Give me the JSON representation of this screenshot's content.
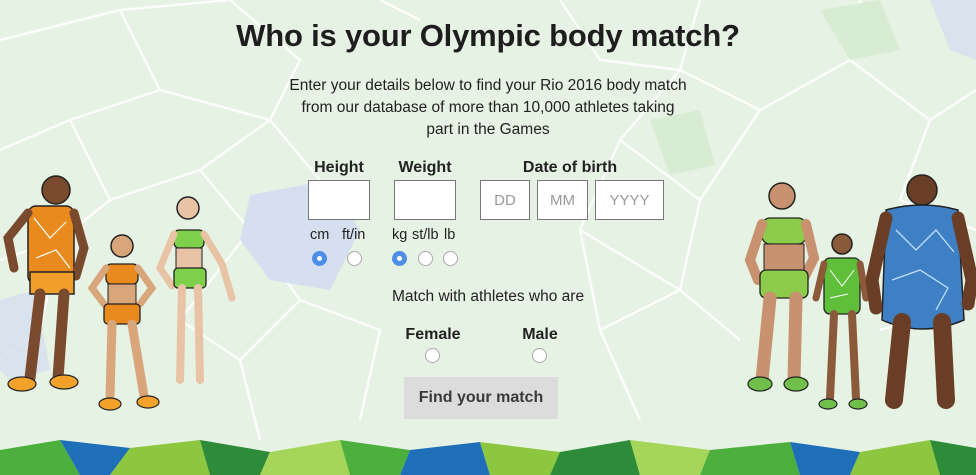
{
  "title": "Who is your Olympic body match?",
  "intro": "Enter your details below to find your Rio 2016 body match from our database of more than 10,000 athletes taking part in the Games",
  "height": {
    "label": "Height",
    "placeholder": "",
    "units": [
      "cm",
      "ft/in"
    ],
    "selected_unit": "cm"
  },
  "weight": {
    "label": "Weight",
    "placeholder": "",
    "units": [
      "kg",
      "st/lb",
      "lb"
    ],
    "selected_unit": "kg"
  },
  "dob": {
    "label": "Date of birth",
    "day_placeholder": "DD",
    "month_placeholder": "MM",
    "year_placeholder": "YYYY"
  },
  "match": {
    "prompt": "Match with athletes who are",
    "options": [
      "Female",
      "Male"
    ],
    "selected": null
  },
  "submit_label": "Find your match",
  "colors": {
    "background": "#e6f2e3",
    "radio_selected": "#4d8fe8",
    "button_bg": "#dcdcdc"
  }
}
